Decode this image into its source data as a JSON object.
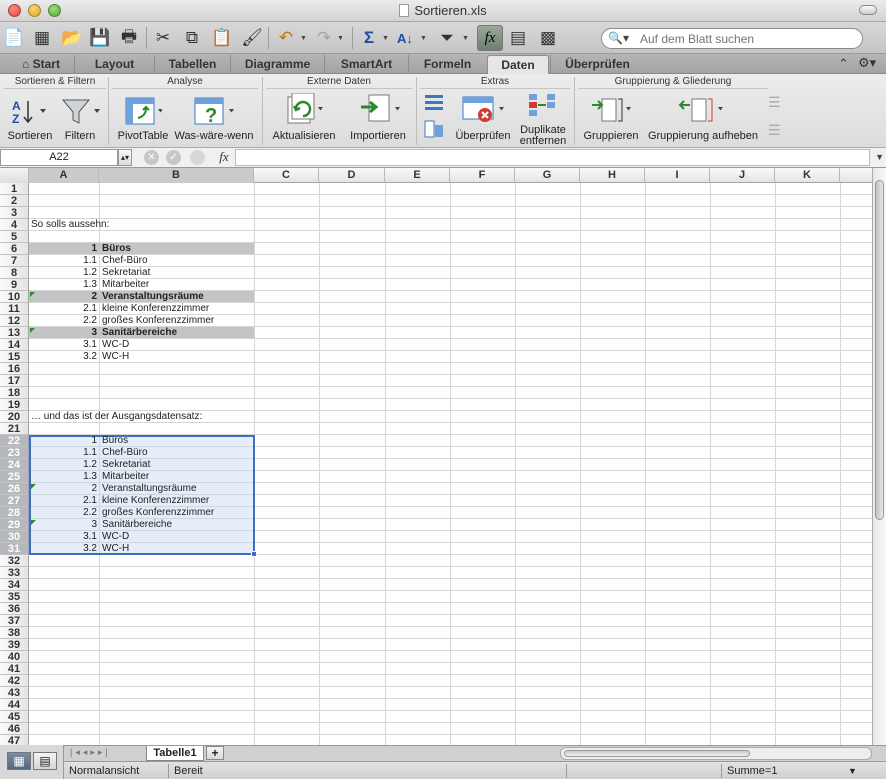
{
  "window": {
    "title": "Sortieren.xls"
  },
  "search": {
    "placeholder": "Auf dem Blatt suchen"
  },
  "tabs": [
    "Start",
    "Layout",
    "Tabellen",
    "Diagramme",
    "SmartArt",
    "Formeln",
    "Daten",
    "Überprüfen"
  ],
  "active_tab": "Daten",
  "ribbon": {
    "groups": [
      "Sortieren & Filtern",
      "Analyse",
      "Externe Daten",
      "Extras",
      "Gruppierung & Gliederung"
    ],
    "buttons": {
      "sort": "Sortieren",
      "filter": "Filtern",
      "pivot": "PivotTable",
      "whatif": "Was-wäre-wenn",
      "refresh": "Aktualisieren",
      "import": "Importieren",
      "validate": "Überprüfen",
      "dup1": "Duplikate",
      "dup2": "entfernen",
      "group": "Gruppieren",
      "ungroup": "Gruppierung aufheben"
    }
  },
  "formula_bar": {
    "name_box": "A22",
    "fx": "fx",
    "formula": ""
  },
  "columns": [
    "A",
    "B",
    "C",
    "D",
    "E",
    "F",
    "G",
    "H",
    "I",
    "J",
    "K"
  ],
  "rows": [
    "1",
    "2",
    "3",
    "4",
    "5",
    "6",
    "7",
    "8",
    "9",
    "10",
    "11",
    "12",
    "13",
    "14",
    "15",
    "16",
    "17",
    "18",
    "19",
    "20",
    "21",
    "22",
    "23",
    "24",
    "25",
    "26",
    "27",
    "28",
    "29",
    "30",
    "31",
    "32",
    "33",
    "34",
    "35",
    "36",
    "37",
    "38",
    "39",
    "40",
    "41",
    "42",
    "43",
    "44",
    "45",
    "46",
    "47"
  ],
  "cells": {
    "r4a": "So solls aussehn:",
    "r6a": "1",
    "r6b": "Büros",
    "r7a": "1.1",
    "r7b": "Chef-Büro",
    "r8a": "1.2",
    "r8b": "Sekretariat",
    "r9a": "1.3",
    "r9b": "Mitarbeiter",
    "r10a": "2",
    "r10b": "Veranstaltungsräume",
    "r11a": "2.1",
    "r11b": "kleine Konferenzzimmer",
    "r12a": "2.2",
    "r12b": "großes Konferenzzimmer",
    "r13a": "3",
    "r13b": "Sanitärbereiche",
    "r14a": "3.1",
    "r14b": "WC-D",
    "r15a": "3.2",
    "r15b": "WC-H",
    "r20a": "… und das ist der Ausgangsdatensatz:",
    "r22a": "1",
    "r22b": "Büros",
    "r23a": "1.1",
    "r23b": "Chef-Büro",
    "r24a": "1.2",
    "r24b": "Sekretariat",
    "r25a": "1.3",
    "r25b": "Mitarbeiter",
    "r26a": "2",
    "r26b": "Veranstaltungsräume",
    "r27a": "2.1",
    "r27b": "kleine Konferenzzimmer",
    "r28a": "2.2",
    "r28b": "großes Konferenzzimmer",
    "r29a": "3",
    "r29b": "Sanitärbereiche",
    "r30a": "3.1",
    "r30b": "WC-D",
    "r31a": "3.2",
    "r31b": "WC-H"
  },
  "sheet_tab": "Tabelle1",
  "status": {
    "view": "Normalansicht",
    "ready": "Bereit",
    "sum": "Summe=1"
  },
  "colors": {
    "selection": "#3b70c5",
    "band": "#c4c4c4"
  }
}
